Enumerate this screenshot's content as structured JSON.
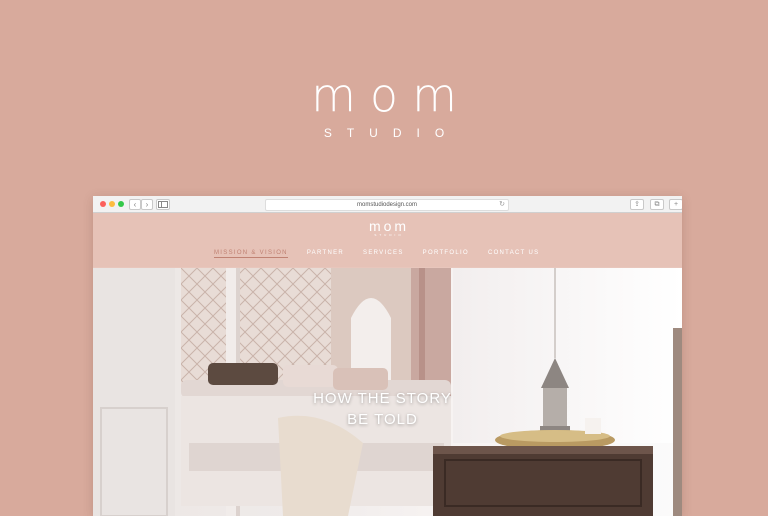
{
  "brand": {
    "name": "mom",
    "subtitle": "STUDIO"
  },
  "browser": {
    "url": "momstudiodesign.com",
    "nav_back": "‹",
    "nav_forward": "›"
  },
  "site": {
    "logo": {
      "name": "mom",
      "subtitle": "STUDIO"
    },
    "nav": [
      {
        "label": "MISSION & VISION"
      },
      {
        "label": "PARTNER"
      },
      {
        "label": "SERVICES"
      },
      {
        "label": "PORTFOLIO"
      },
      {
        "label": "CONTACT US"
      }
    ],
    "hero": {
      "line1": "HOW THE STORY",
      "line2": "BE TOLD"
    }
  },
  "colors": {
    "background": "#d8aa9c",
    "header": "#e6c2b7",
    "active_nav": "#c08273"
  }
}
